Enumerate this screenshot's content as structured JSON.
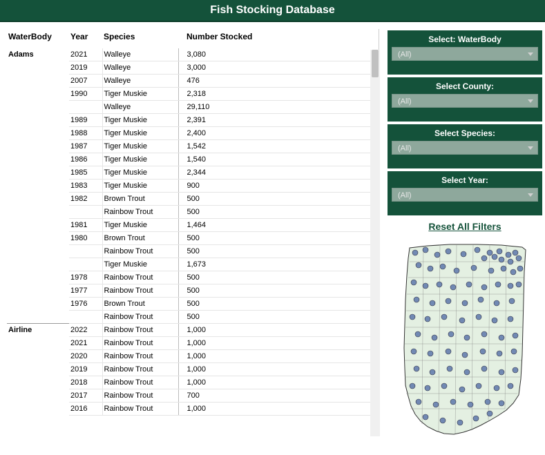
{
  "header": {
    "title": "Fish Stocking Database"
  },
  "table": {
    "headers": {
      "waterbody": "WaterBody",
      "year": "Year",
      "species": "Species",
      "number": "Number Stocked"
    },
    "rows": [
      {
        "waterbody": "Adams",
        "year": "2021",
        "species": "Walleye",
        "number": "3,080",
        "newSection": true
      },
      {
        "waterbody": "",
        "year": "2019",
        "species": "Walleye",
        "number": "3,000"
      },
      {
        "waterbody": "",
        "year": "2007",
        "species": "Walleye",
        "number": "476"
      },
      {
        "waterbody": "",
        "year": "1990",
        "species": "Tiger Muskie",
        "number": "2,318"
      },
      {
        "waterbody": "",
        "year": "",
        "species": "Walleye",
        "number": "29,110"
      },
      {
        "waterbody": "",
        "year": "1989",
        "species": "Tiger Muskie",
        "number": "2,391"
      },
      {
        "waterbody": "",
        "year": "1988",
        "species": "Tiger Muskie",
        "number": "2,400"
      },
      {
        "waterbody": "",
        "year": "1987",
        "species": "Tiger Muskie",
        "number": "1,542"
      },
      {
        "waterbody": "",
        "year": "1986",
        "species": "Tiger Muskie",
        "number": "1,540"
      },
      {
        "waterbody": "",
        "year": "1985",
        "species": "Tiger Muskie",
        "number": "2,344"
      },
      {
        "waterbody": "",
        "year": "1983",
        "species": "Tiger Muskie",
        "number": "900"
      },
      {
        "waterbody": "",
        "year": "1982",
        "species": "Brown Trout",
        "number": "500"
      },
      {
        "waterbody": "",
        "year": "",
        "species": "Rainbow Trout",
        "number": "500"
      },
      {
        "waterbody": "",
        "year": "1981",
        "species": "Tiger Muskie",
        "number": "1,464"
      },
      {
        "waterbody": "",
        "year": "1980",
        "species": "Brown Trout",
        "number": "500"
      },
      {
        "waterbody": "",
        "year": "",
        "species": "Rainbow Trout",
        "number": "500"
      },
      {
        "waterbody": "",
        "year": "",
        "species": "Tiger Muskie",
        "number": "1,673"
      },
      {
        "waterbody": "",
        "year": "1978",
        "species": "Rainbow Trout",
        "number": "500"
      },
      {
        "waterbody": "",
        "year": "1977",
        "species": "Rainbow Trout",
        "number": "500"
      },
      {
        "waterbody": "",
        "year": "1976",
        "species": "Brown Trout",
        "number": "500"
      },
      {
        "waterbody": "",
        "year": "",
        "species": "Rainbow Trout",
        "number": "500"
      },
      {
        "waterbody": "Airline",
        "year": "2022",
        "species": "Rainbow Trout",
        "number": "1,000",
        "newSection": true
      },
      {
        "waterbody": "",
        "year": "2021",
        "species": "Rainbow Trout",
        "number": "1,000"
      },
      {
        "waterbody": "",
        "year": "2020",
        "species": "Rainbow Trout",
        "number": "1,000"
      },
      {
        "waterbody": "",
        "year": "2019",
        "species": "Rainbow Trout",
        "number": "1,000"
      },
      {
        "waterbody": "",
        "year": "2018",
        "species": "Rainbow Trout",
        "number": "1,000"
      },
      {
        "waterbody": "",
        "year": "2017",
        "species": "Rainbow Trout",
        "number": "700"
      },
      {
        "waterbody": "",
        "year": "2016",
        "species": "Rainbow Trout",
        "number": "1,000"
      }
    ]
  },
  "filters": [
    {
      "label": "Select: WaterBody",
      "value": "(All)"
    },
    {
      "label": "Select County:",
      "value": "(All)"
    },
    {
      "label": "Select Species:",
      "value": "(All)"
    },
    {
      "label": "Select Year:",
      "value": "(All)"
    }
  ],
  "reset": {
    "label": "Reset All Filters"
  },
  "colors": {
    "green": "#14523a",
    "selectBg": "#8ea89c",
    "mapFill": "#e4f0e2",
    "dotFill": "#7189b3"
  }
}
